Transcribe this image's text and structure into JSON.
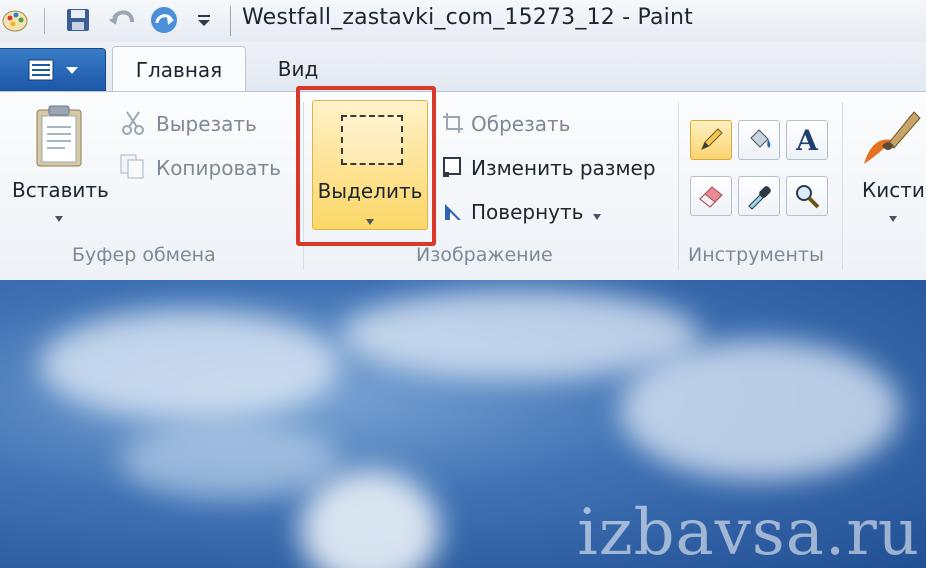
{
  "window": {
    "title": "Westfall_zastavki_com_15273_12 - Paint"
  },
  "quick_access": {
    "icons": [
      "paint-app-icon",
      "save-icon",
      "undo-icon",
      "redo-icon",
      "customize-dropdown-icon"
    ]
  },
  "tabs": [
    {
      "label": "Главная",
      "active": true
    },
    {
      "label": "Вид",
      "active": false
    }
  ],
  "clipboard": {
    "paste_label": "Вставить",
    "cut_label": "Вырезать",
    "copy_label": "Копировать",
    "group_label": "Буфер обмена"
  },
  "image": {
    "select_label": "Выделить",
    "crop_label": "Обрезать",
    "resize_label": "Изменить размер",
    "rotate_label": "Повернуть",
    "group_label": "Изображение"
  },
  "tools": {
    "group_label": "Инструменты",
    "items": [
      "pencil-icon",
      "fill-icon",
      "text-icon",
      "eraser-icon",
      "color-picker-icon",
      "magnifier-icon"
    ],
    "text_tool_glyph": "A"
  },
  "brushes": {
    "label": "Кисти"
  },
  "canvas": {
    "watermark": "izbavsa.ru"
  },
  "colors": {
    "highlight_border": "#d9392b",
    "select_button": "#fcd868",
    "app_button": "#1b57a7"
  }
}
